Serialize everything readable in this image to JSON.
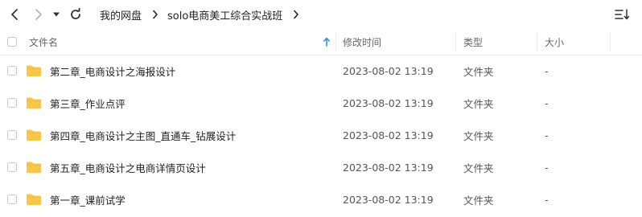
{
  "toolbar": {
    "back_icon": "chevron-left-icon",
    "forward_icon": "chevron-right-icon",
    "history_dropdown_icon": "caret-down-icon",
    "refresh_icon": "refresh-icon",
    "view_sort_icon": "list-sort-icon"
  },
  "breadcrumb": {
    "items": [
      "我的网盘",
      "solo电商美工综合实战班"
    ],
    "separator_icon": "chevron-right-icon"
  },
  "table": {
    "headers": {
      "name": "文件名",
      "modified": "修改时间",
      "type": "类型",
      "size": "大小"
    },
    "sort_icon": "arrow-up-icon",
    "rows": [
      {
        "name": "第二章_电商设计之海报设计",
        "modified": "2023-08-02 13:19",
        "type": "文件夹",
        "size": "-"
      },
      {
        "name": "第三章_作业点评",
        "modified": "2023-08-02 13:19",
        "type": "文件夹",
        "size": "-"
      },
      {
        "name": "第四章_电商设计之主图_直通车_钻展设计",
        "modified": "2023-08-02 13:19",
        "type": "文件夹",
        "size": "-"
      },
      {
        "name": "第五章_电商设计之电商详情页设计",
        "modified": "2023-08-02 13:19",
        "type": "文件夹",
        "size": "-"
      },
      {
        "name": "第一章_课前试学",
        "modified": "2023-08-02 13:19",
        "type": "文件夹",
        "size": "-"
      }
    ]
  },
  "colors": {
    "folder": "#F7C64A",
    "accent": "#2F8EF7"
  }
}
